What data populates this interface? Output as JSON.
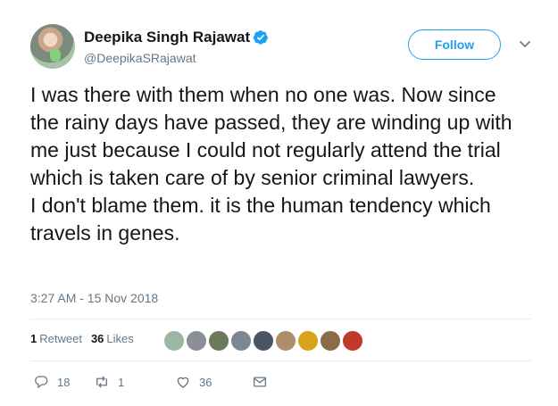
{
  "author": {
    "display_name": "Deepika Singh Rajawat",
    "handle": "@DeepikaSRajawat",
    "verified": true
  },
  "follow_label": "Follow",
  "tweet": {
    "text": "I was there with them when no one was. Now since  the rainy days have passed, they are winding up with me just because I could not regularly attend the trial which is taken care of by senior criminal lawyers.\nI don't blame them. it is the human tendency which travels in genes.",
    "timestamp": "3:27 AM - 15 Nov 2018"
  },
  "stats": {
    "retweets_count": "1",
    "retweets_label": "Retweet",
    "likes_count": "36",
    "likes_label": "Likes"
  },
  "liker_avatars": [
    "#9bb7a4",
    "#8a8f96",
    "#6b7a5a",
    "#7c8794",
    "#4b5563",
    "#b08d6a",
    "#d9a21b",
    "#8b6b4a",
    "#c0392b"
  ],
  "actions": {
    "reply_count": "18",
    "retweet_count": "1",
    "like_count": "36"
  },
  "colors": {
    "accent": "#1da1f2",
    "muted": "#657786",
    "text": "#14171a"
  },
  "icons": [
    "verified-badge-icon",
    "chevron-down-icon",
    "reply-icon",
    "retweet-icon",
    "heart-icon",
    "envelope-icon"
  ]
}
